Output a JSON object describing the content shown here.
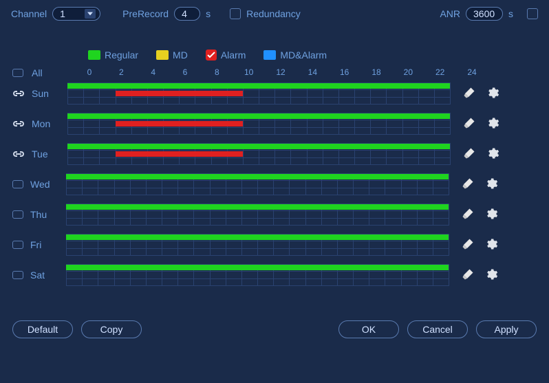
{
  "top": {
    "channel_label": "Channel",
    "channel_value": "1",
    "prerecord_label": "PreRecord",
    "prerecord_value": "4",
    "prerecord_unit": "s",
    "redundancy_label": "Redundancy",
    "anr_label": "ANR",
    "anr_value": "3600",
    "anr_unit": "s"
  },
  "legend": {
    "regular": "Regular",
    "md": "MD",
    "alarm": "Alarm",
    "md_alarm": "MD&Alarm",
    "alarm_checked": true
  },
  "hours": [
    "0",
    "2",
    "4",
    "6",
    "8",
    "10",
    "12",
    "14",
    "16",
    "18",
    "20",
    "22",
    "24"
  ],
  "all_label": "All",
  "days": [
    {
      "name": "Sun",
      "linked": true,
      "segments": [
        {
          "type": "green",
          "start": 0,
          "end": 24,
          "lane": 0
        },
        {
          "type": "red",
          "start": 3,
          "end": 11,
          "lane": 1
        }
      ]
    },
    {
      "name": "Mon",
      "linked": true,
      "segments": [
        {
          "type": "green",
          "start": 0,
          "end": 24,
          "lane": 0
        },
        {
          "type": "red",
          "start": 3,
          "end": 11,
          "lane": 1
        }
      ]
    },
    {
      "name": "Tue",
      "linked": true,
      "segments": [
        {
          "type": "green",
          "start": 0,
          "end": 24,
          "lane": 0
        },
        {
          "type": "red",
          "start": 3,
          "end": 11,
          "lane": 1
        }
      ]
    },
    {
      "name": "Wed",
      "linked": false,
      "segments": [
        {
          "type": "green",
          "start": 0,
          "end": 24,
          "lane": 0
        }
      ]
    },
    {
      "name": "Thu",
      "linked": false,
      "segments": [
        {
          "type": "green",
          "start": 0,
          "end": 24,
          "lane": 0
        }
      ]
    },
    {
      "name": "Fri",
      "linked": false,
      "segments": [
        {
          "type": "green",
          "start": 0,
          "end": 24,
          "lane": 0
        }
      ]
    },
    {
      "name": "Sat",
      "linked": false,
      "segments": [
        {
          "type": "green",
          "start": 0,
          "end": 24,
          "lane": 0
        }
      ]
    }
  ],
  "buttons": {
    "default": "Default",
    "copy": "Copy",
    "ok": "OK",
    "cancel": "Cancel",
    "apply": "Apply"
  },
  "colors": {
    "regular": "#1fd41f",
    "md": "#e6d020",
    "alarm": "#e02020",
    "md_alarm": "#2090ff"
  }
}
